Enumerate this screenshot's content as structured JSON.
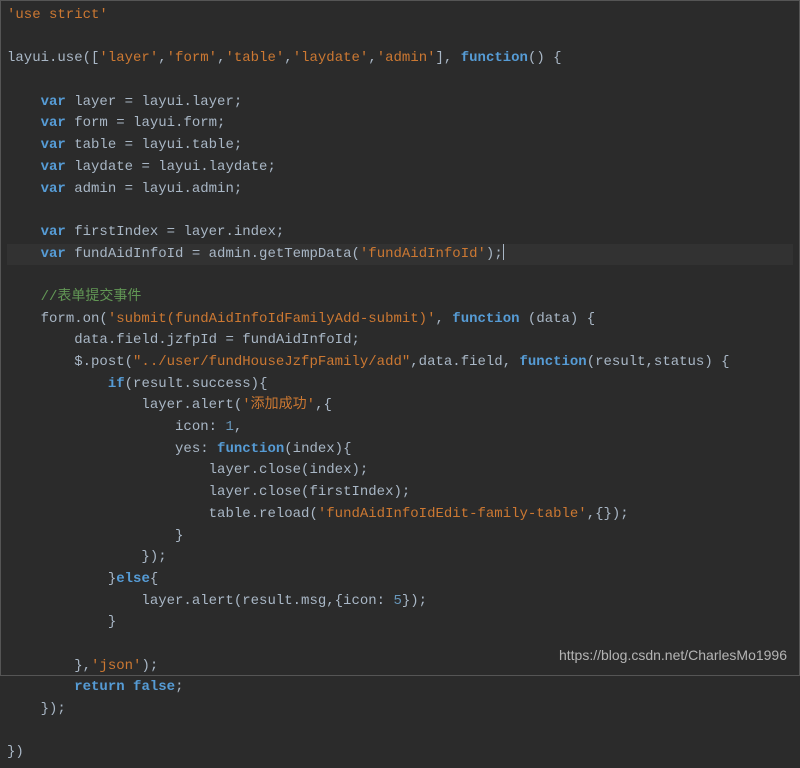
{
  "code": {
    "l1": "'use strict'",
    "l2_a": "layui.use([",
    "l2_s1": "'layer'",
    "l2_s2": "'form'",
    "l2_s3": "'table'",
    "l2_s4": "'laydate'",
    "l2_s5": "'admin'",
    "l2_b": "], ",
    "l2_fn": "function",
    "l2_c": "() {",
    "var": "var",
    "l3": " layer = layui.layer;",
    "l4": " form = layui.form;",
    "l5": " table = layui.table;",
    "l6": " laydate = layui.laydate;",
    "l7": " admin = layui.admin;",
    "l8": " firstIndex = layer.index;",
    "l9_a": " fundAidInfoId = admin.getTempData(",
    "l9_s": "'fundAidInfoId'",
    "l9_b": ");",
    "cmt": "//表单提交事件",
    "l10_a": "form.on(",
    "l10_s": "'submit(fundAidInfoIdFamilyAdd-submit)'",
    "l10_b": ", ",
    "l10_c": " (data) {",
    "l11": "data.field.jzfpId = fundAidInfoId;",
    "l12_a": "$.post(",
    "l12_s": "\"../user/fundHouseJzfpFamily/add\"",
    "l12_b": ",data.field, ",
    "l12_c": "(result,status) {",
    "if": "if",
    "l13": "(result.success){",
    "l14_a": "layer.alert(",
    "l14_s": "'添加成功'",
    "l14_b": ",{",
    "l15": "icon: ",
    "l15_n": "1",
    "l15_b": ",",
    "l16_a": "yes: ",
    "l16_b": "(index){",
    "l17": "layer.close(index);",
    "l18": "layer.close(firstIndex);",
    "l19_a": "table.reload(",
    "l19_s": "'fundAidInfoIdEdit-family-table'",
    "l19_b": ",{});",
    "brace_c": "}",
    "l20": "});",
    "else": "else",
    "l21": "{",
    "l22_a": "layer.alert(result.msg,{icon: ",
    "l22_n": "5",
    "l22_b": "});",
    "l23_a": "},",
    "l23_s": "'json'",
    "l23_b": ");",
    "return": "return",
    "false": "false",
    "semi": ";",
    "l24": "});",
    "l25": "})"
  },
  "watermark": "https://blog.csdn.net/CharlesMo1996"
}
